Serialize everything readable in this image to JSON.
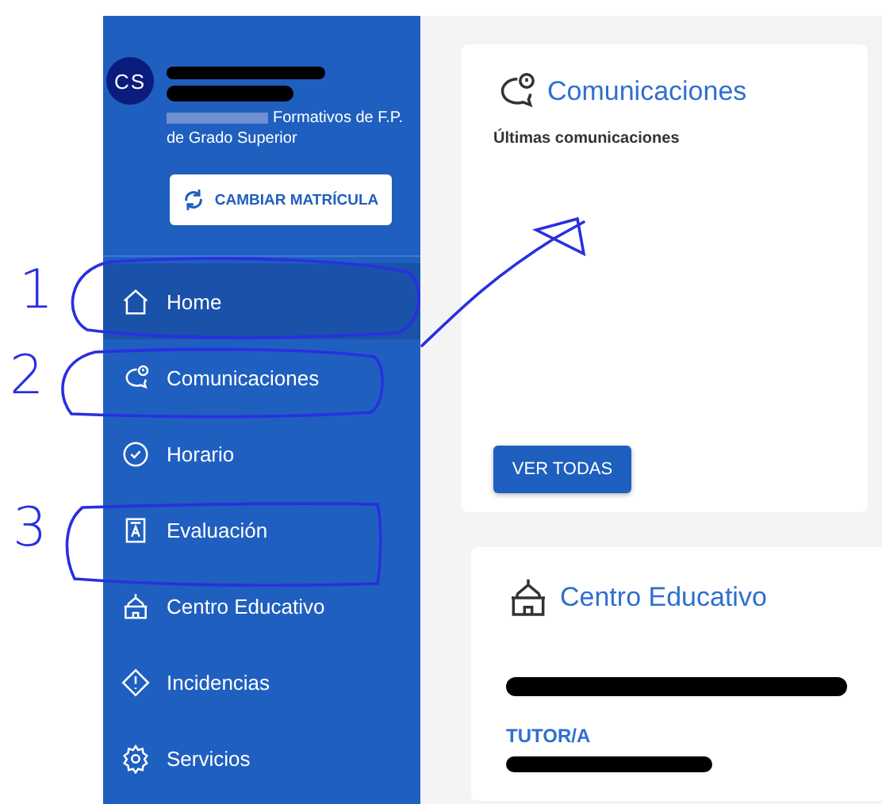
{
  "profile": {
    "avatar_initials": "CS",
    "program_lines": [
      "Formativos de F.P.",
      "de Grado Superior"
    ],
    "change_button": "CAMBIAR MATRÍCULA"
  },
  "menu": [
    {
      "label": "Home",
      "kind": "home",
      "selected": true
    },
    {
      "label": "Comunicaciones",
      "kind": "chat",
      "selected": false
    },
    {
      "label": "Horario",
      "kind": "clock",
      "selected": false
    },
    {
      "label": "Evaluación",
      "kind": "grade",
      "selected": false
    },
    {
      "label": "Centro Educativo",
      "kind": "school",
      "selected": false
    },
    {
      "label": "Incidencias",
      "kind": "warning",
      "selected": false
    },
    {
      "label": "Servicios",
      "kind": "gear",
      "selected": false
    }
  ],
  "cards": [
    {
      "kind": "communications",
      "title": "Comunicaciones",
      "subtitle": "Últimas comunicaciones",
      "button": "VER TODAS"
    },
    {
      "kind": "school",
      "title": "Centro Educativo",
      "section_label": "TUTOR/A"
    }
  ],
  "annotations": [
    {
      "label": "1"
    },
    {
      "label": "2"
    },
    {
      "label": "3"
    }
  ]
}
